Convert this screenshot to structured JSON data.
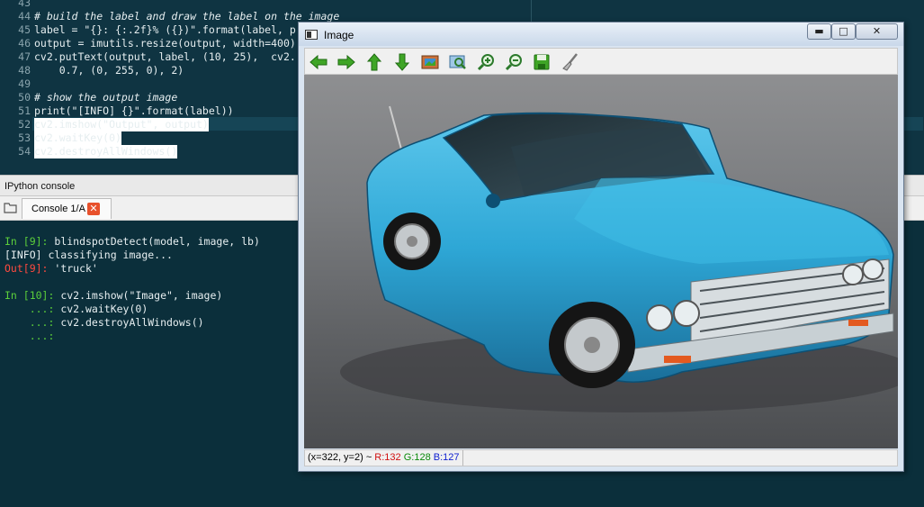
{
  "editor": {
    "lines": [
      {
        "num": "43",
        "code": ""
      },
      {
        "num": "44",
        "code": "# build the label and draw the label on the image"
      },
      {
        "num": "45",
        "code": "label = \"{}: {:.2f}% ({})\".format(label, p"
      },
      {
        "num": "46",
        "code": "output = imutils.resize(output, width=400)"
      },
      {
        "num": "47",
        "code": "cv2.putText(output, label, (10, 25),  cv2."
      },
      {
        "num": "48",
        "code": "    0.7, (0, 255, 0), 2)"
      },
      {
        "num": "49",
        "code": ""
      },
      {
        "num": "50",
        "code": "# show the output image"
      },
      {
        "num": "51",
        "code": "print(\"[INFO] {}\".format(label))"
      },
      {
        "num": "52",
        "code": "cv2.imshow(\"Output\", output)"
      },
      {
        "num": "53",
        "code": "cv2.waitKey(0)"
      },
      {
        "num": "54",
        "code": "cv2.destroyAllWindows()"
      }
    ]
  },
  "console": {
    "header": "IPython console",
    "tab_label": "Console 1/A",
    "close_glyph": "✕",
    "lines": [
      {
        "prompt": "In [9]: ",
        "text": "blindspotDetect(model, image, lb)",
        "kind": "in"
      },
      {
        "prompt": "",
        "text": "[INFO] classifying image...",
        "kind": "plain"
      },
      {
        "prompt": "Out[9]: ",
        "text": "'truck'",
        "kind": "out"
      },
      {
        "prompt": "",
        "text": "",
        "kind": "plain"
      },
      {
        "prompt": "In [10]: ",
        "text": "cv2.imshow(\"Image\", image)",
        "kind": "in"
      },
      {
        "prompt": "    ...: ",
        "text": "cv2.waitKey(0)",
        "kind": "in"
      },
      {
        "prompt": "    ...: ",
        "text": "cv2.destroyAllWindows()",
        "kind": "in"
      },
      {
        "prompt": "    ...:",
        "text": "",
        "kind": "in"
      }
    ]
  },
  "image_window": {
    "title": "Image",
    "minimize_glyph": "▬",
    "maximize_glyph": "□",
    "close_glyph": "✕",
    "toolbar": [
      {
        "name": "pan-left-icon"
      },
      {
        "name": "pan-right-icon"
      },
      {
        "name": "pan-up-icon"
      },
      {
        "name": "pan-down-icon"
      },
      {
        "name": "zoom-original-icon"
      },
      {
        "name": "zoom-fit-icon"
      },
      {
        "name": "zoom-in-icon"
      },
      {
        "name": "zoom-out-icon"
      },
      {
        "name": "save-icon"
      },
      {
        "name": "properties-brush-icon"
      }
    ],
    "status": {
      "coords": "(x=322, y=2) ~ ",
      "r": "R:132",
      "g": "G:128",
      "b": "B:127"
    }
  },
  "colors": {
    "editor_bg": "#0f3442",
    "console_bg": "#0b2f3b",
    "car_body": "#2ea7d6",
    "prompt_in": "#5ccf3b",
    "prompt_out": "#ff4a3f"
  }
}
